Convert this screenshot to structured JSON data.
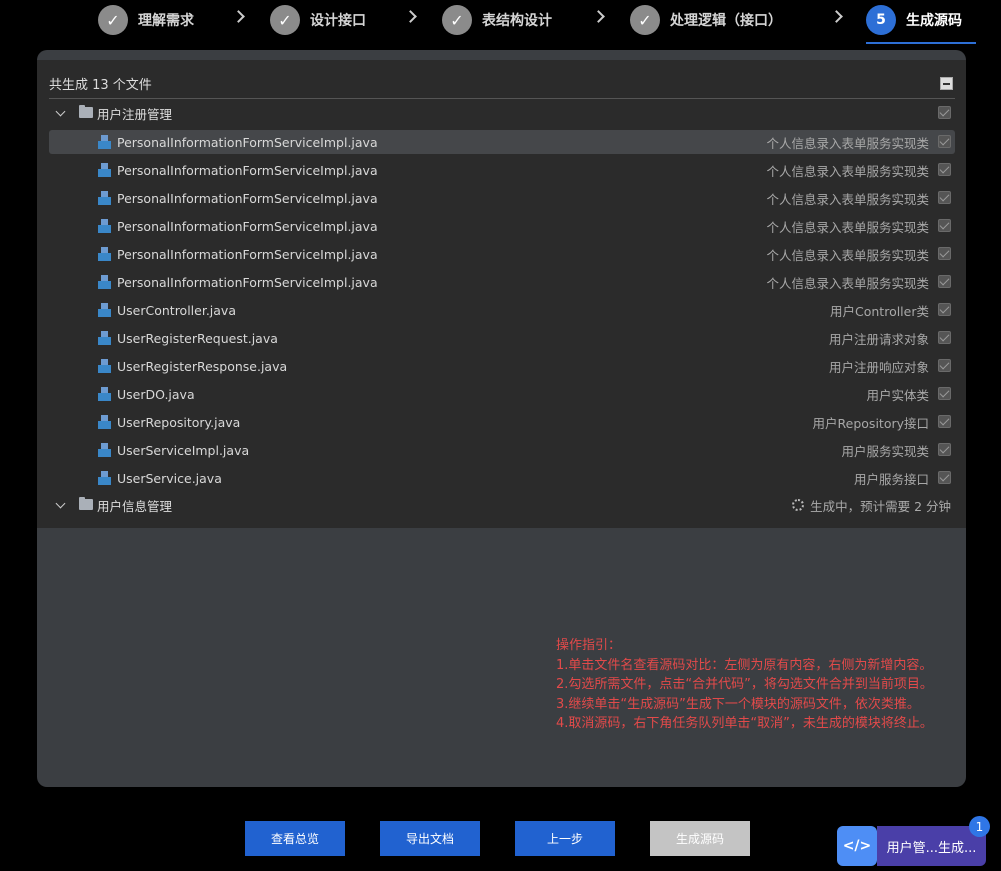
{
  "stepper": {
    "steps": [
      {
        "label": "理解需求",
        "state": "done"
      },
      {
        "label": "设计接口",
        "state": "done"
      },
      {
        "label": "表结构设计",
        "state": "done"
      },
      {
        "label": "处理逻辑（接口）",
        "state": "done"
      },
      {
        "label": "生成源码",
        "number": "5",
        "state": "active"
      }
    ]
  },
  "panel": {
    "summary": "共生成 13 个文件",
    "groups": [
      {
        "name": "用户注册管理",
        "expanded": true,
        "checked": true,
        "files": [
          {
            "name": "PersonalInformationFormServiceImpl.java",
            "desc": "个人信息录入表单服务实现类",
            "selected": true
          },
          {
            "name": "PersonalInformationFormServiceImpl.java",
            "desc": "个人信息录入表单服务实现类"
          },
          {
            "name": "PersonalInformationFormServiceImpl.java",
            "desc": "个人信息录入表单服务实现类"
          },
          {
            "name": "PersonalInformationFormServiceImpl.java",
            "desc": "个人信息录入表单服务实现类"
          },
          {
            "name": "PersonalInformationFormServiceImpl.java",
            "desc": "个人信息录入表单服务实现类"
          },
          {
            "name": "PersonalInformationFormServiceImpl.java",
            "desc": "个人信息录入表单服务实现类"
          },
          {
            "name": "UserController.java",
            "desc": "用户Controller类"
          },
          {
            "name": "UserRegisterRequest.java",
            "desc": "用户注册请求对象"
          },
          {
            "name": "UserRegisterResponse.java",
            "desc": "用户注册响应对象"
          },
          {
            "name": "UserDO.java",
            "desc": "用户实体类"
          },
          {
            "name": "UserRepository.java",
            "desc": "用户Repository接口"
          },
          {
            "name": "UserServiceImpl.java",
            "desc": "用户服务实现类"
          },
          {
            "name": "UserService.java",
            "desc": "用户服务接口"
          }
        ]
      },
      {
        "name": "用户信息管理",
        "expanded": false,
        "status": "生成中，预计需要 2 分钟"
      }
    ]
  },
  "guide": {
    "title": "操作指引：",
    "lines": [
      "1.单击文件名查看源码对比：左侧为原有内容，右侧为新增内容。",
      "2.勾选所需文件，点击“合并代码”，将勾选文件合并到当前项目。",
      "3.继续单击“生成源码”生成下一个模块的源码文件，依次类推。",
      "4.取消源码，右下角任务队列单击“取消”，未生成的模块将终止。"
    ]
  },
  "buttons": {
    "overview": "查看总览",
    "export": "导出文档",
    "prev": "上一步",
    "generate": "生成源码"
  },
  "queue": {
    "icon": "code-icon",
    "label": "用户管...生成...",
    "badge": "1"
  },
  "colors": {
    "accent": "#2162d0",
    "guide_text": "#e24a4a",
    "queue_bg": "#4a3fa8"
  }
}
